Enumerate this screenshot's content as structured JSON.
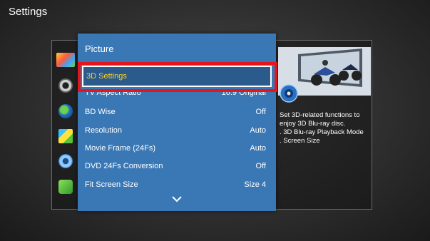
{
  "header": {
    "title": "Settings"
  },
  "sidebar": {
    "icons": [
      {
        "name": "picture-icon"
      },
      {
        "name": "sound-icon"
      },
      {
        "name": "network-icon"
      },
      {
        "name": "system-icon"
      },
      {
        "name": "settings-gear-icon"
      },
      {
        "name": "support-icon"
      }
    ]
  },
  "menu": {
    "title": "Picture",
    "selected": {
      "label": "3D Settings"
    },
    "items": [
      {
        "label": "TV Aspect Ratio",
        "value": "16:9 Original"
      },
      {
        "label": "BD Wise",
        "value": "Off"
      },
      {
        "label": "Resolution",
        "value": "Auto"
      },
      {
        "label": "Movie Frame (24Fs)",
        "value": "Auto"
      },
      {
        "label": "DVD 24Fs Conversion",
        "value": "Off"
      },
      {
        "label": "Fit Screen Size",
        "value": "Size 4"
      }
    ]
  },
  "description": {
    "lines": [
      "Set 3D-related functions to",
      "enjoy 3D Blu-ray disc.",
      ". 3D Blu-ray Playback Mode",
      ". Screen Size"
    ]
  },
  "colors": {
    "menu_bg": "#3a78b5",
    "selected_bg": "#2b5a8c",
    "highlight_red": "#e3151d",
    "selected_text": "#ffd21c"
  }
}
